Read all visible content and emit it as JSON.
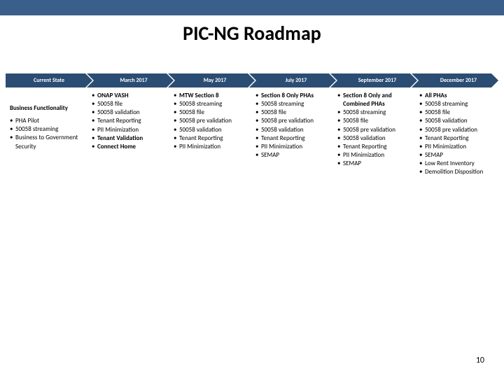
{
  "title": "PIC-NG Roadmap",
  "page_number": "10",
  "columns": [
    {
      "header": "Current State",
      "heading": "Business Functionality",
      "items": [
        "PHA Pilot",
        "50058 streaming",
        "Business to Government Security"
      ]
    },
    {
      "header": "March 2017",
      "lead": "ONAP VASH",
      "items": [
        "50058 file",
        "50058 validation",
        "Tenant Reporting",
        "PII Minimization",
        "Tenant Validation",
        "Connect Home"
      ],
      "bold_items": [
        4,
        5
      ]
    },
    {
      "header": "May 2017",
      "lead": "MTW Section 8",
      "items": [
        "50058 streaming",
        "50058 file",
        "50058 pre validation",
        "50058 validation",
        "Tenant Reporting",
        "PII Minimization"
      ]
    },
    {
      "header": "July 2017",
      "lead": "Section 8 Only PHAs",
      "items": [
        "50058 streaming",
        "50058 file",
        "50058 pre validation",
        "50058 validation",
        "Tenant Reporting",
        "PII Minimization",
        "SEMAP"
      ]
    },
    {
      "header": "September 2017",
      "lead": "Section 8 Only and Combined PHAs",
      "items": [
        "50058 streaming",
        "50058 file",
        "50058 pre validation",
        "50058 validation",
        "Tenant Reporting",
        "PII Minimization",
        "SEMAP"
      ]
    },
    {
      "header": "December 2017",
      "lead": "All PHAs",
      "items": [
        "50058 streaming",
        "50058 file",
        "50058 validation",
        "50058 pre validation",
        "Tenant Reporting",
        "PII Minimization",
        "SEMAP",
        "Low Rent Inventory",
        "Demolition Disposition"
      ]
    }
  ]
}
